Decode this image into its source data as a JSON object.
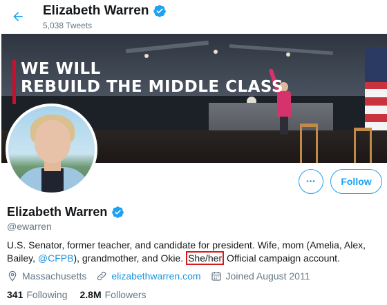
{
  "header": {
    "name": "Elizabeth Warren",
    "tweet_count": "5,038 Tweets",
    "back_icon": "arrow-left-icon",
    "verified_icon": "verified-badge-icon"
  },
  "banner": {
    "line1": "WE WILL",
    "line2": "REBUILD THE MIDDLE CLASS"
  },
  "actions": {
    "more_label": "•••",
    "follow_label": "Follow"
  },
  "profile": {
    "name": "Elizabeth Warren",
    "handle": "@ewarren",
    "bio": {
      "part1": "U.S. Senator, former teacher, and candidate for president. Wife, mom (Amelia, Alex, Bailey, ",
      "mention": "@CFPB",
      "part2": "), grandmother, and Okie. ",
      "pronouns": "She/her",
      "part3": " Official campaign account."
    },
    "location": "Massachusetts",
    "website": "elizabethwarren.com",
    "joined": "Joined August 2011",
    "following_count": "341",
    "following_label": "Following",
    "followers_count": "2.8M",
    "followers_label": "Followers"
  },
  "colors": {
    "accent": "#1da1f2",
    "link": "#1b95e0",
    "muted": "#657786",
    "highlight_box": "#d61a1a"
  }
}
